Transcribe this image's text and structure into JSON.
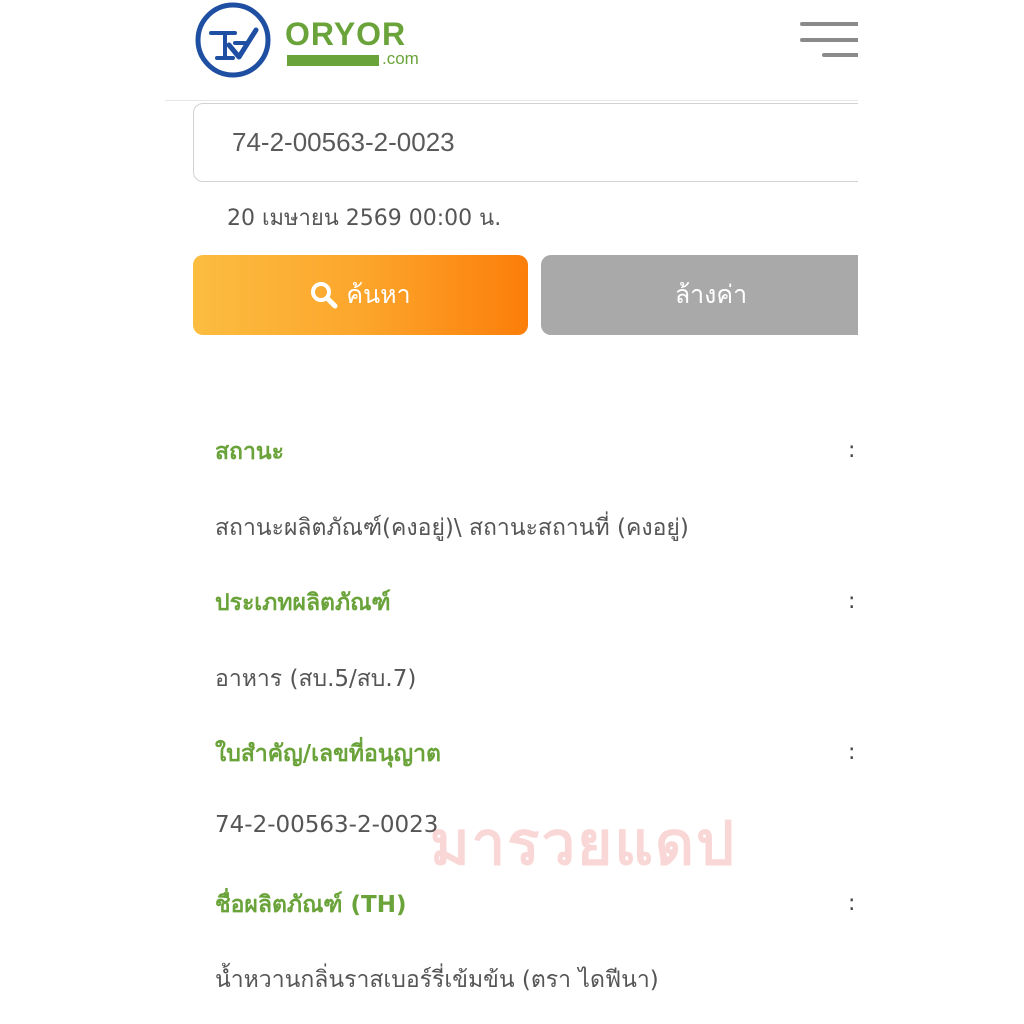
{
  "header": {
    "logo_name": "ORYOR",
    "logo_domain": ".com",
    "menu_icon": "hamburger-menu-icon"
  },
  "search": {
    "input_value": "74-2-00563-2-0023",
    "timestamp": "20 เมษายน 2569 00:00 น.",
    "search_button_label": "ค้นหา",
    "search_icon": "search-icon",
    "clear_button_label": "ล้างค่า"
  },
  "colors": {
    "brand_green": "#6aa33a",
    "search_button": "#fb8c1a",
    "clear_button": "#a9a9a9"
  },
  "results": [
    {
      "label": "สถานะ",
      "colon": ":",
      "value": "สถานะผลิตภัณฑ์(คงอยู่)\\ สถานะสถานที่ (คงอยู่)"
    },
    {
      "label": "ประเภทผลิตภัณฑ์",
      "colon": ":",
      "value": "อาหาร (สบ.5/สบ.7)"
    },
    {
      "label": "ใบสำคัญ/เลขที่อนุญาต",
      "colon": ":",
      "value": "74-2-00563-2-0023"
    },
    {
      "label": "ชื่อผลิตภัณฑ์ (TH)",
      "colon": ":",
      "value": "น้ำหวานกลิ่นราสเบอร์รี่เข้มข้น (ตรา ไดฟีนา)"
    }
  ],
  "watermark": "มารวยแดป"
}
